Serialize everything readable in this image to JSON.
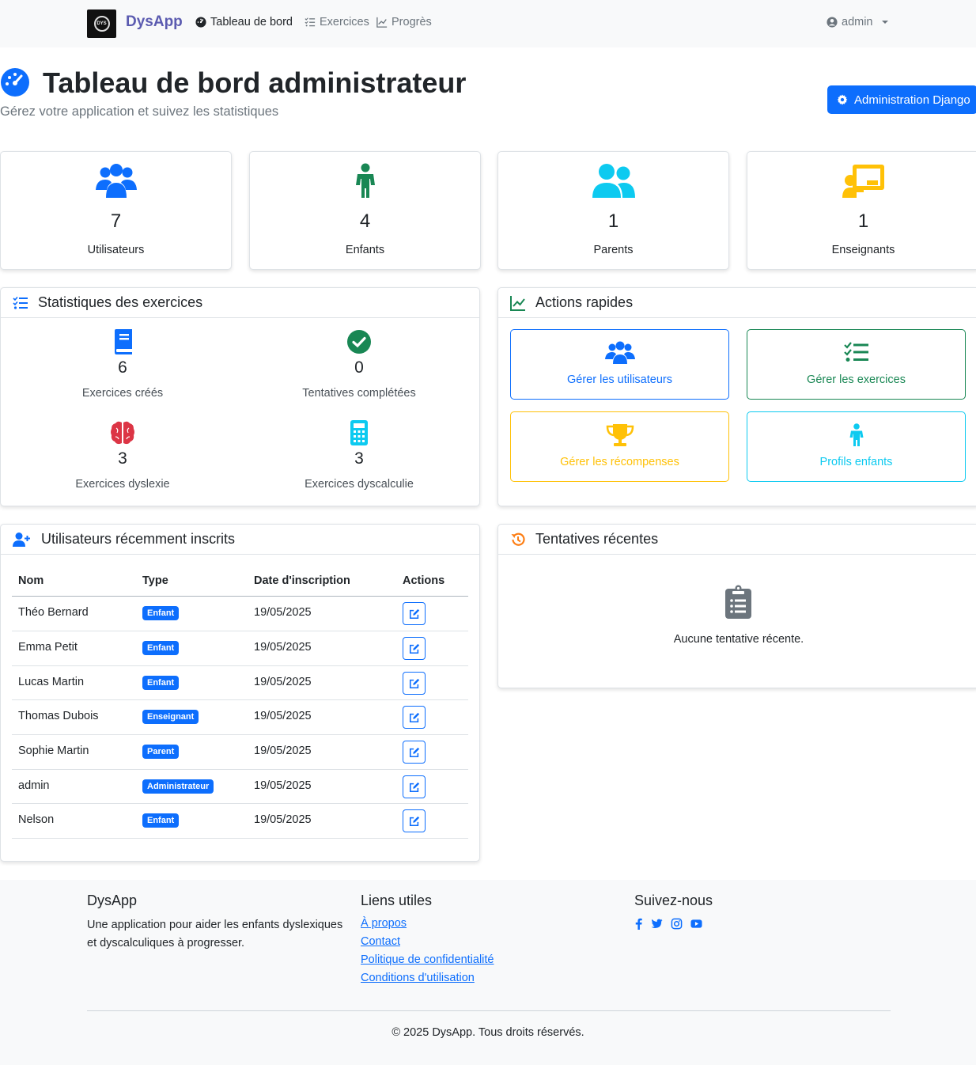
{
  "navbar": {
    "logo_text": "DYS",
    "brand": "DysApp",
    "items": [
      {
        "label": "Tableau de bord",
        "icon": "gauge-icon"
      },
      {
        "label": "Exercices",
        "icon": "list-check-icon"
      },
      {
        "label": "Progrès",
        "icon": "chart-line-icon"
      }
    ],
    "user": "admin"
  },
  "header": {
    "title": "Tableau de bord administrateur",
    "subtitle": "Gérez votre application et suivez les statistiques",
    "admin_button": "Administration Django"
  },
  "stats": [
    {
      "value": "7",
      "label": "Utilisateurs",
      "icon": "users-icon",
      "color": "#0d6efd"
    },
    {
      "value": "4",
      "label": "Enfants",
      "icon": "child-icon",
      "color": "#198754"
    },
    {
      "value": "1",
      "label": "Parents",
      "icon": "user-friends-icon",
      "color": "#0dcaf0"
    },
    {
      "value": "1",
      "label": "Enseignants",
      "icon": "chalkboard-teacher-icon",
      "color": "#ffc107"
    }
  ],
  "exercise_stats": {
    "title": "Statistiques des exercices",
    "items": [
      {
        "value": "6",
        "label": "Exercices créés",
        "icon": "book-icon"
      },
      {
        "value": "0",
        "label": "Tentatives complétées",
        "icon": "check-circle-icon"
      },
      {
        "value": "3",
        "label": "Exercices dyslexie",
        "icon": "brain-icon"
      },
      {
        "value": "3",
        "label": "Exercices dyscalculie",
        "icon": "calculator-icon"
      }
    ]
  },
  "quick_actions": {
    "title": "Actions rapides",
    "items": [
      {
        "label": "Gérer les utilisateurs",
        "color": "#0d6efd"
      },
      {
        "label": "Gérer les exercices",
        "color": "#198754"
      },
      {
        "label": "Gérer les récompenses",
        "color": "#ffc107"
      },
      {
        "label": "Profils enfants",
        "color": "#0dcaf0"
      }
    ]
  },
  "recent_users": {
    "title": "Utilisateurs récemment inscrits",
    "columns": [
      "Nom",
      "Type",
      "Date d'inscription",
      "Actions"
    ],
    "rows": [
      {
        "name": "Théo Bernard",
        "type": "Enfant",
        "date": "19/05/2025"
      },
      {
        "name": "Emma Petit",
        "type": "Enfant",
        "date": "19/05/2025"
      },
      {
        "name": "Lucas Martin",
        "type": "Enfant",
        "date": "19/05/2025"
      },
      {
        "name": "Thomas Dubois",
        "type": "Enseignant",
        "date": "19/05/2025"
      },
      {
        "name": "Sophie Martin",
        "type": "Parent",
        "date": "19/05/2025"
      },
      {
        "name": "admin",
        "type": "Administrateur",
        "date": "19/05/2025"
      },
      {
        "name": "Nelson",
        "type": "Enfant",
        "date": "19/05/2025"
      }
    ]
  },
  "recent_attempts": {
    "title": "Tentatives récentes",
    "empty_text": "Aucune tentative récente."
  },
  "footer": {
    "brand": "DysApp",
    "description": "Une application pour aider les enfants dyslexiques et dyscalculiques à progresser.",
    "links_title": "Liens utiles",
    "links": [
      "À propos",
      "Contact",
      "Politique de confidentialité",
      "Conditions d'utilisation"
    ],
    "social_title": "Suivez-nous",
    "social": [
      "facebook-icon",
      "twitter-icon",
      "instagram-icon",
      "youtube-icon"
    ],
    "copyright": "© 2025 DysApp. Tous droits réservés."
  },
  "colors": {
    "primary": "#0d6efd",
    "success": "#198754",
    "info": "#0dcaf0",
    "warning": "#ffc107",
    "danger": "#dc3545"
  }
}
